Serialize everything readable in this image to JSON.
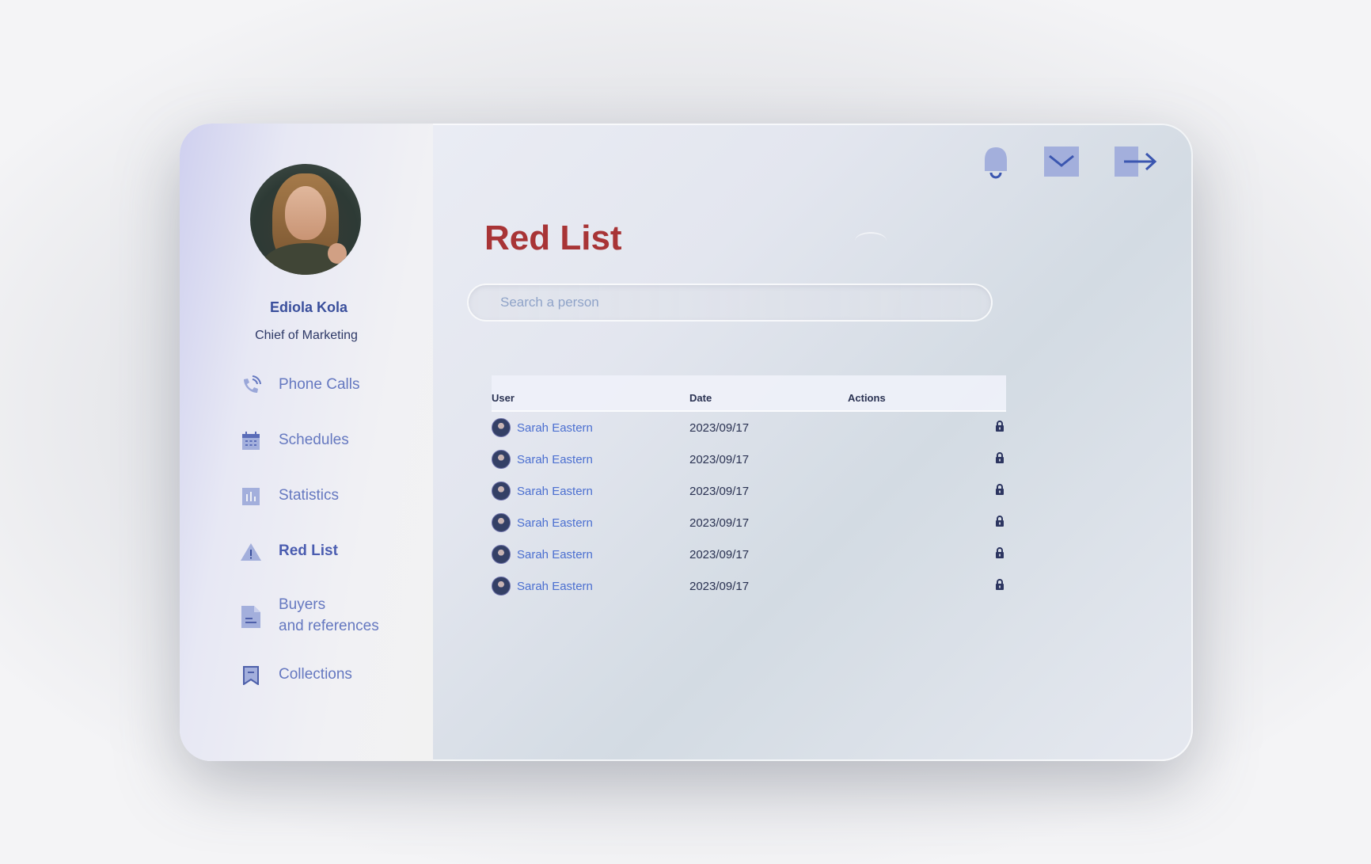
{
  "profile": {
    "name": "Ediola Kola",
    "role": "Chief of Marketing"
  },
  "nav": [
    {
      "label": "Phone Calls",
      "icon": "phone-icon"
    },
    {
      "label": "Schedules",
      "icon": "calendar-icon"
    },
    {
      "label": "Statistics",
      "icon": "bar-chart-icon"
    },
    {
      "label": "Red List",
      "icon": "warning-icon",
      "active": true
    },
    {
      "label_line1": "Buyers",
      "label_line2": "and references",
      "icon": "document-icon"
    },
    {
      "label": "Collections",
      "icon": "bookmark-icon"
    }
  ],
  "header": {
    "icons": [
      "bell-icon",
      "mail-icon",
      "logout-icon"
    ]
  },
  "page": {
    "title": "Red List"
  },
  "search": {
    "placeholder": "Search a person",
    "value": ""
  },
  "table": {
    "columns": [
      "User",
      "Date",
      "Actions"
    ],
    "rows": [
      {
        "user": "Sarah Eastern",
        "date": "2023/09/17",
        "action_icon": "lock-icon"
      },
      {
        "user": "Sarah Eastern",
        "date": "2023/09/17",
        "action_icon": "lock-icon"
      },
      {
        "user": "Sarah Eastern",
        "date": "2023/09/17",
        "action_icon": "lock-icon"
      },
      {
        "user": "Sarah Eastern",
        "date": "2023/09/17",
        "action_icon": "lock-icon"
      },
      {
        "user": "Sarah Eastern",
        "date": "2023/09/17",
        "action_icon": "lock-icon"
      },
      {
        "user": "Sarah Eastern",
        "date": "2023/09/17",
        "action_icon": "lock-icon"
      }
    ]
  },
  "colors": {
    "accent": "#6578c0",
    "title": "#a83436",
    "link": "#4b6fd0",
    "icon": "#8e9fd6"
  }
}
